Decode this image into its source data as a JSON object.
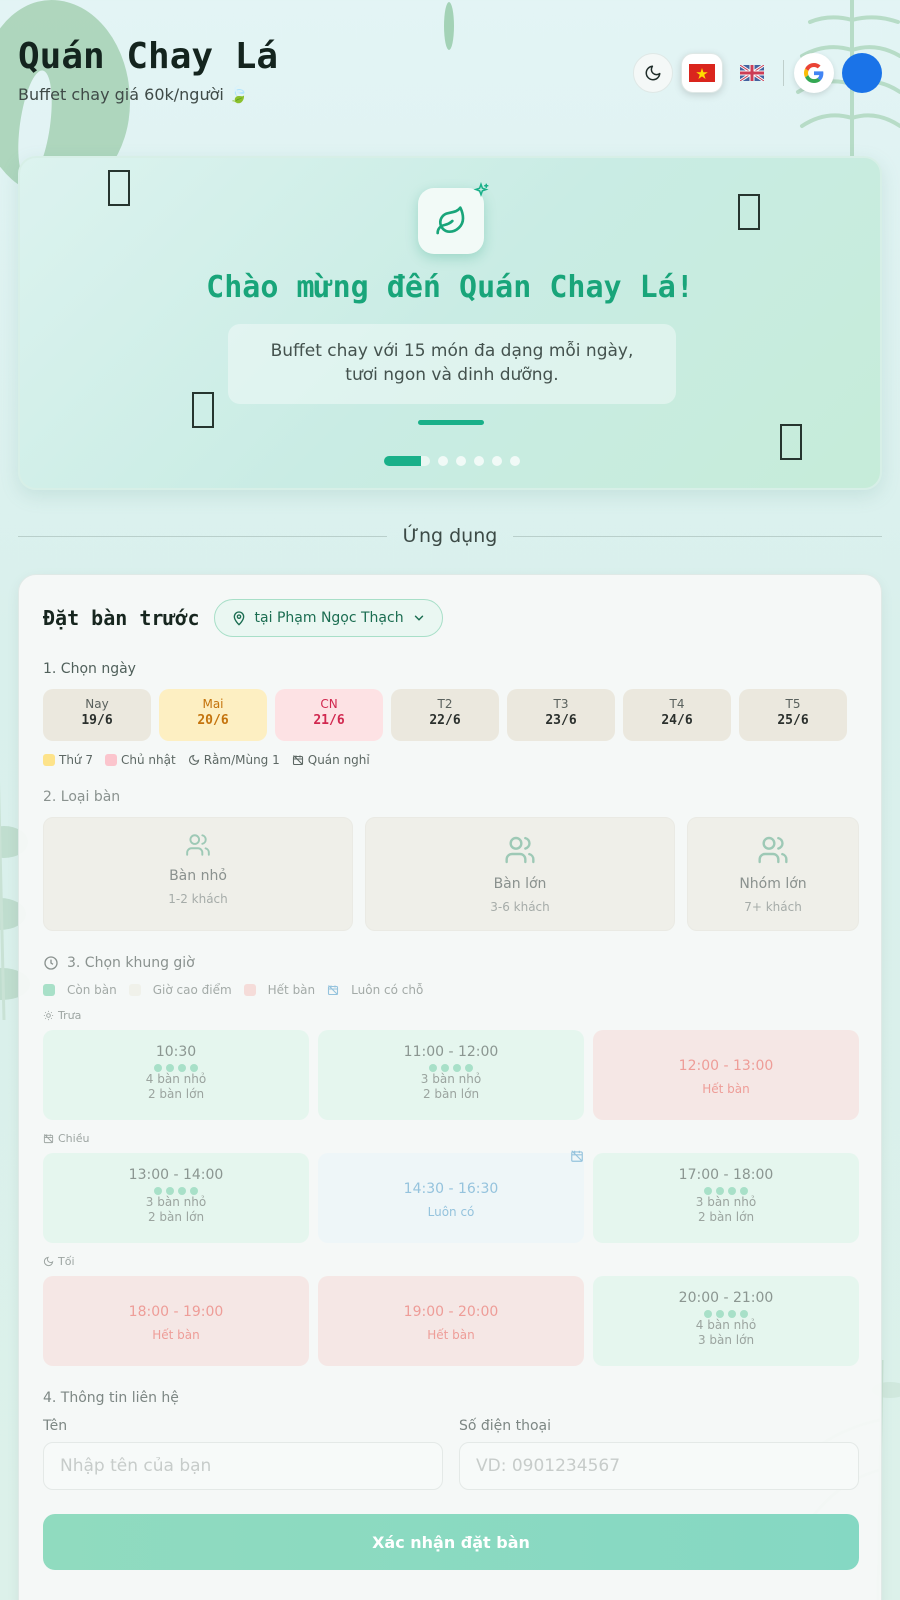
{
  "header": {
    "title": "Quán Chay Lá",
    "subtitle": "Buffet chay giá 60k/người 🍃",
    "buttons": {
      "theme_icon": "moon-icon",
      "lang_vi_icon": "vietnam-flag-icon",
      "lang_en_icon": "uk-flag-icon",
      "google_icon": "google-icon"
    }
  },
  "hero": {
    "title": "Chào mừng đến Quán Chay Lá!",
    "description": "Buffet chay với 15 món đa dạng mỗi ngày, tươi ngon và dinh dưỡng.",
    "slide_count": 6,
    "active_slide": 1
  },
  "section": {
    "label": "Ứng dụng"
  },
  "booking": {
    "title": "Đặt bàn trước",
    "location": "tại Phạm Ngọc Thạch",
    "step1": "1. Chọn ngày",
    "days": [
      {
        "name": "Nay",
        "date": "19/6",
        "kind": "normal"
      },
      {
        "name": "Mai",
        "date": "20/6",
        "kind": "sat"
      },
      {
        "name": "CN",
        "date": "21/6",
        "kind": "sun"
      },
      {
        "name": "T2",
        "date": "22/6",
        "kind": "normal"
      },
      {
        "name": "T3",
        "date": "23/6",
        "kind": "normal"
      },
      {
        "name": "T4",
        "date": "24/6",
        "kind": "normal"
      },
      {
        "name": "T5",
        "date": "25/6",
        "kind": "normal"
      }
    ],
    "day_legend": {
      "saturday": "Thứ 7",
      "sunday": "Chủ nhật",
      "full_moon": "Rằm/Mùng 1",
      "closed": "Quán nghỉ"
    },
    "step2": "2. Loại bàn",
    "table_types": [
      {
        "name": "Bàn nhỏ",
        "capacity": "1-2 khách"
      },
      {
        "name": "Bàn lớn",
        "capacity": "3-6 khách"
      },
      {
        "name": "Nhóm lớn",
        "capacity": "7+ khách"
      }
    ],
    "step3": "3. Chọn khung giờ",
    "slot_legend": {
      "available": "Còn bàn",
      "peak": "Giờ cao điểm",
      "full": "Hết bàn",
      "always": "Luôn có chỗ"
    },
    "periods": {
      "lunch": {
        "label": "Trưa",
        "slots": [
          {
            "time": "10:30",
            "status": "avail",
            "small": "4 bàn nhỏ",
            "large": "2 bàn lớn"
          },
          {
            "time": "11:00 - 12:00",
            "status": "avail",
            "small": "3 bàn nhỏ",
            "large": "2 bàn lớn"
          },
          {
            "time": "12:00 - 13:00",
            "status": "full",
            "note": "Hết bàn"
          }
        ]
      },
      "afternoon": {
        "label": "Chiều",
        "slots": [
          {
            "time": "13:00 - 14:00",
            "status": "avail",
            "small": "3 bàn nhỏ",
            "large": "2 bàn lớn"
          },
          {
            "time": "14:30 - 16:30",
            "status": "always",
            "note": "Luôn có"
          },
          {
            "time": "17:00 - 18:00",
            "status": "avail",
            "small": "3 bàn nhỏ",
            "large": "2 bàn lớn"
          }
        ]
      },
      "evening": {
        "label": "Tối",
        "slots": [
          {
            "time": "18:00 - 19:00",
            "status": "full",
            "note": "Hết bàn"
          },
          {
            "time": "19:00 - 20:00",
            "status": "full",
            "note": "Hết bàn"
          },
          {
            "time": "20:00 - 21:00",
            "status": "avail",
            "small": "4 bàn nhỏ",
            "large": "3 bàn lớn"
          }
        ]
      }
    },
    "step4": "4. Thông tin liên hệ",
    "name_label": "Tên",
    "name_placeholder": "Nhập tên của bạn",
    "phone_label": "Số điện thoại",
    "phone_placeholder": "VD: 0901234567",
    "submit_label": "Xác nhận đặt bàn"
  },
  "colors": {
    "accent": "#19b089",
    "saturday": "#fdefc2",
    "sunday": "#fde2e4",
    "available": "#a8e0c8",
    "full": "#f5dcd9",
    "always": "#95c3dd"
  }
}
